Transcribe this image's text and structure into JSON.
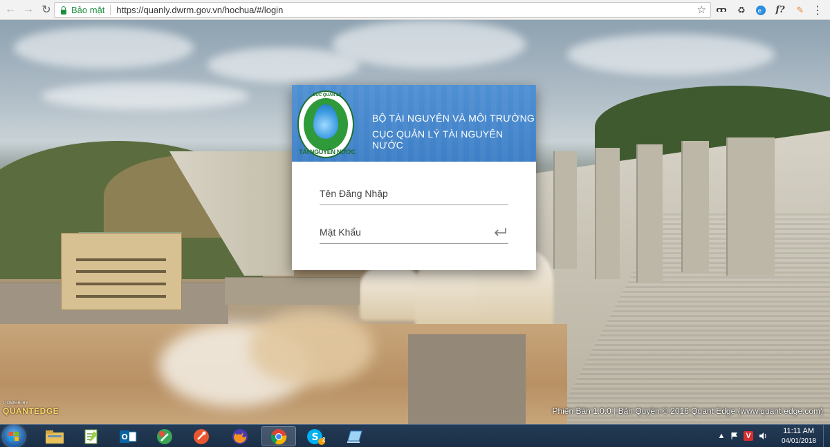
{
  "browser": {
    "secure_label": "Bảo mật",
    "url": "https://quanly.dwrm.gov.vn/hochua/#/login"
  },
  "login": {
    "org_line1": "BỘ TÀI NGUYÊN VÀ MÔI TRƯỜNG",
    "org_line2": "CỤC QUẢN LÝ TÀI NGUYÊN NƯỚC",
    "logo_top_text": "CỤC QUẢN LÝ",
    "logo_bottom_text": "TÀI NGUYÊN NƯỚC",
    "username_placeholder": "Tên Đăng Nhập",
    "password_placeholder": "Mật Khẩu"
  },
  "footer": {
    "power_by": "POWER BY",
    "brand": "QUANTEDGE",
    "version": "Phiên Bản 1.0.0 | Bản Quyền © 2016 Quant Edge (www.quant-edge.com)"
  },
  "taskbar": {
    "time": "11:11 AM",
    "date": "04/01/2018",
    "skype_badge": "2"
  },
  "colors": {
    "header_blue": "#4f90d3",
    "secure_green": "#1e8e3e",
    "taskbar": "#1a2f47"
  }
}
